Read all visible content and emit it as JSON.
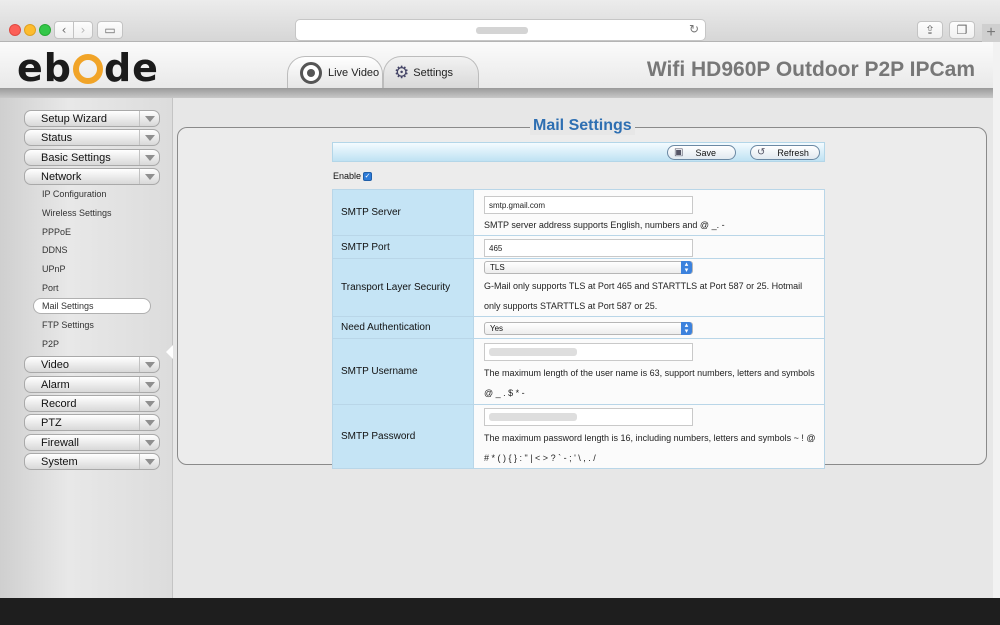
{
  "app": {
    "device_title": "Wifi HD960P Outdoor P2P IPCam",
    "logo_parts": [
      "eb",
      "de"
    ]
  },
  "nav_tabs": [
    {
      "label": "Live Video",
      "icon": "webcam-icon"
    },
    {
      "label": "Settings",
      "icon": "gears-icon"
    }
  ],
  "sidebar": {
    "menu": [
      "Setup Wizard",
      "Status",
      "Basic Settings",
      "Network",
      "Video",
      "Alarm",
      "Record",
      "PTZ",
      "Firewall",
      "System"
    ],
    "network_items": [
      "IP Configuration",
      "Wireless Settings",
      "PPPoE",
      "DDNS",
      "UPnP",
      "Port",
      "Mail Settings",
      "FTP Settings",
      "P2P"
    ],
    "active_item": "Mail Settings"
  },
  "mail": {
    "title": "Mail Settings",
    "save_label": "Save",
    "refresh_label": "Refresh",
    "enable_label": "Enable",
    "enabled": true,
    "rows": {
      "smtp_server": {
        "label": "SMTP Server",
        "value": "smtp.gmail.com",
        "hint": "SMTP server address supports English, numbers and @ _. -"
      },
      "smtp_port": {
        "label": "SMTP Port",
        "value": "465"
      },
      "tls": {
        "label": "Transport Layer Security",
        "value": "TLS",
        "hint": "G-Mail only supports TLS at Port 465 and STARTTLS at Port 587 or 25. Hotmail only supports STARTTLS at Port 587 or 25."
      },
      "auth": {
        "label": "Need Authentication",
        "value": "Yes"
      },
      "username": {
        "label": "SMTP Username",
        "hint": "The maximum length of the user name is 63, support numbers, letters and symbols @ _ . $ * -"
      },
      "password": {
        "label": "SMTP Password",
        "hint": "The maximum password length is 16, including numbers, letters and symbols ~ ! @ # * ( )   { } : \" | < > ? ` - ; ' \\ , . /"
      }
    }
  },
  "colors": {
    "accent": "#2e6fb2",
    "label_bg": "#c5e4f5",
    "logo_o": "#f1a428"
  }
}
